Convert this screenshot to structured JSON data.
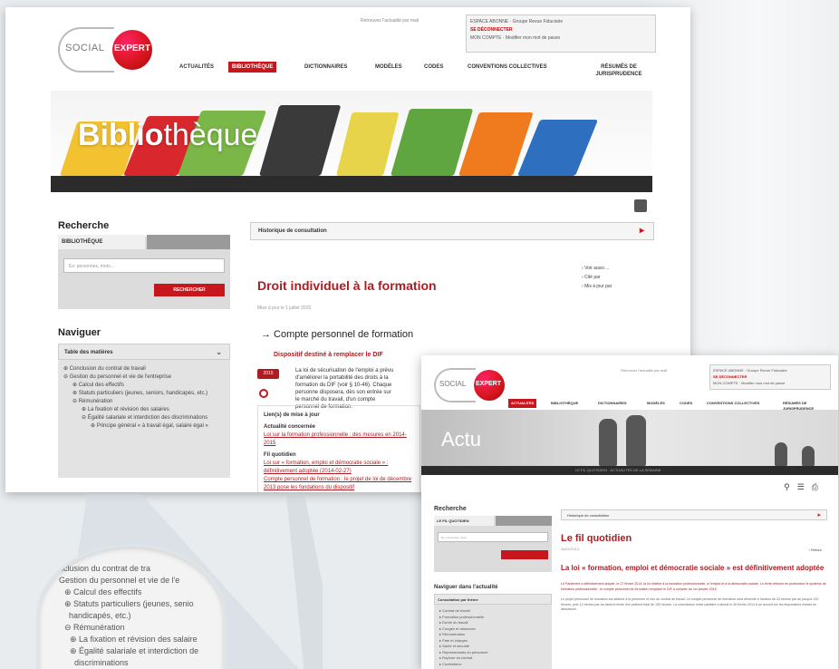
{
  "screen1": {
    "logo": {
      "social": "SOCIAL",
      "expert": "EXPERT"
    },
    "top_links": "Retrouvez l'actualité par mail",
    "account": {
      "line1": "ESPACE ABONNE · Groupe Revue Fiduciaire",
      "line2": "SE DÉCONNECTER",
      "line3": "MON COMPTE · Modifier mon mot de passe"
    },
    "nav": [
      "ACTUALITÉS",
      "BIBLIOTHÈQUE",
      "DICTIONNAIRES",
      "MODÈLES",
      "CODES",
      "CONVENTIONS COLLECTIVES",
      "RÉSUMÉS DE JURISPRUDENCE"
    ],
    "nav_active_index": 1,
    "banner_title_bold": "Biblio",
    "banner_title_rest": "thèque",
    "sidebar": {
      "search_heading": "Recherche",
      "tab_active": "BIBLIOTHÈQUE",
      "tab_inactive": "",
      "search_placeholder": "Ex: personnes, mots...",
      "search_button": "RECHERCHER",
      "browse_heading": "Naviguer",
      "toc_heading": "Table des matières",
      "toc_items": [
        {
          "level": 1,
          "text": "Conclusion du contrat de travail"
        },
        {
          "level": 1,
          "text": "Gestion du personnel et vie de l'entreprise"
        },
        {
          "level": 2,
          "text": "Calcul des effectifs"
        },
        {
          "level": 2,
          "text": "Statuts particuliers (jeunes, seniors, handicapés, etc.)"
        },
        {
          "level": 2,
          "text": "Rémunération"
        },
        {
          "level": 3,
          "text": "La fixation et révision des salaires"
        },
        {
          "level": 3,
          "text": "Égalité salariale et interdiction des discriminations"
        },
        {
          "level": 4,
          "text": "Principe général « à travail égal, salaire égal »"
        }
      ]
    },
    "content": {
      "history_bar": "Historique de consultation",
      "side_links": [
        "Voir aussi ...",
        "Cité par",
        "Mis à jour par"
      ],
      "title": "Droit individuel à la formation",
      "date": "Mise à jour le 1 juillet 2015",
      "subtitle": "→ Compte personnel de formation",
      "red_heading": "Dispositif destiné à remplacer le DIF",
      "badge": "2015",
      "paragraph": "La loi de sécurisation de l'emploi a prévu d'améliorer la portabilité des droits à la formation du DIF (voir § 10-46). Chaque personne disposera, dès son entrée sur le marché du travail, d'un compte personnel de formation.",
      "update_box": {
        "heading": "Lien(s) de mise à jour",
        "current_label": "Actualité concernée",
        "current_link": "Loi sur la formation professionnelle : des mesures en 2014-2015",
        "thread_label": "Fil quotidien",
        "thread_links": [
          "Loi sur « formation, emploi et démocratie sociale » : définitivement adoptée (2014-02-27)",
          "Compte personnel de formation : le projet de loi de décembre 2013 pose les fondations du dispositif"
        ]
      }
    }
  },
  "screen2": {
    "logo": {
      "social": "SOCIAL",
      "expert": "EXPERT"
    },
    "top_links": "Retrouvez l'actualité par mail",
    "account": {
      "line1": "ESPACE ABONNE · Groupe Revue Fiduciaire",
      "line2": "SE DÉCONNECTER",
      "line3": "MON COMPTE · Modifier mon mot de passe"
    },
    "nav": [
      "ACTUALITÉS",
      "BIBLIOTHÈQUE",
      "DICTIONNAIRES",
      "MODÈLES",
      "CODES",
      "CONVENTIONS COLLECTIVES",
      "RÉSUMÉS DE JURISPRUDENCE"
    ],
    "nav_active_index": 0,
    "banner_title": "Actu",
    "banner_strip": "LE FIL QUOTIDIEN · ACTUALITÉS DE LA SEMAINE",
    "sidebar": {
      "search_heading": "Recherche",
      "tab_active": "LE FIL QUOTIDIEN",
      "search_placeholder": "Ex: personnes, mots...",
      "browse_heading": "Naviguer dans l'actualité",
      "category_heading": "Consultation par thème",
      "categories": [
        "Contrat de travail",
        "Formation professionnelle",
        "Durée du travail",
        "Congés et absences",
        "Rémunération",
        "Paie et charges",
        "Santé et sécurité",
        "Représentants du personnel",
        "Rupture du contrat",
        "Contentieux"
      ]
    },
    "main": {
      "history_bar": "Historique de consultation",
      "title": "Le fil quotidien",
      "date": "28/02/2014",
      "back": "Retour",
      "article_title": "La loi « formation, emploi et démocratie sociale » est définitivement adoptée",
      "article_lead": "Le Parlement a définitivement adopté, le 27 février 2014, la loi relative à la formation professionnelle, à l'emploi et à la démocratie sociale. Le texte réforme en profondeur le système de formation professionnelle : le compte personnel de formation remplace le DIF à compter du 1er janvier 2015.",
      "article_body": "Le projet personnel de formation est attaché à la personne et non au contrat de travail. Le compte personnel de formation sera alimenté à hauteur de 24 heures par an jusqu'à 120 heures, puis 12 heures par an dans la limite d'un plafond total de 150 heures. La commission mixte paritaire a abouti le 26 février 2014 à un accord sur les dispositions restant en discussion."
    }
  },
  "magnifier": {
    "lines": [
      {
        "level": 1,
        "text": "nclusion du contrat de tra"
      },
      {
        "level": 1,
        "text": "Gestion du personnel et vie de l'e"
      },
      {
        "level": 2,
        "text": "Calcul des effectifs"
      },
      {
        "level": 2,
        "text": "Statuts particuliers (jeunes, senio"
      },
      {
        "level": 2,
        "text": "handicapés, etc.)"
      },
      {
        "level": 2,
        "text": "Rémunération"
      },
      {
        "level": 3,
        "text": "La fixation et révision des salaire"
      },
      {
        "level": 3,
        "text": "Égalité salariale et interdiction de"
      },
      {
        "level": 3,
        "text": "discriminations"
      }
    ]
  },
  "colors": {
    "brand_red": "#c8161d",
    "title_red": "#b01a20",
    "shelf": "#2b2b2b"
  }
}
